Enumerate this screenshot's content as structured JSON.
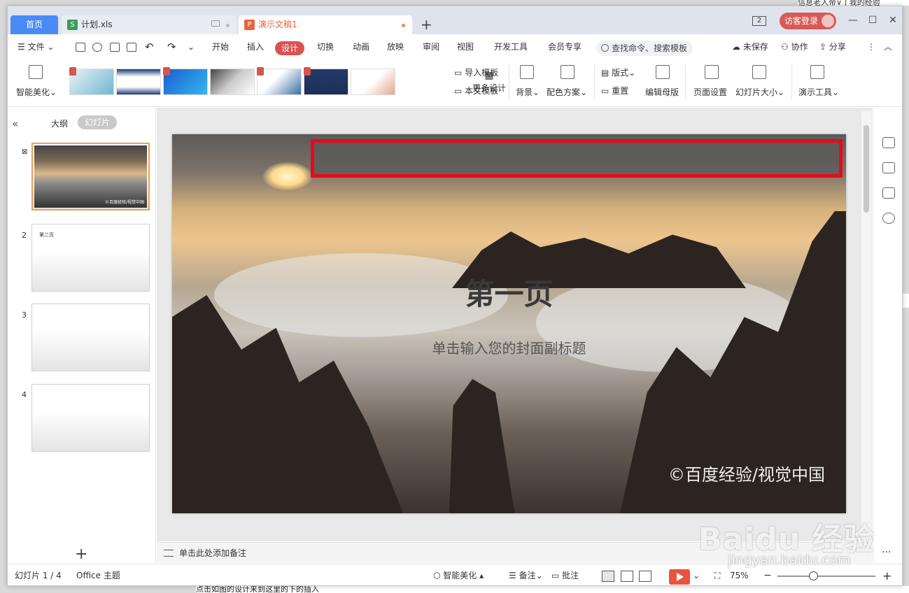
{
  "outside": {
    "top_text": "信息老人帝∨ | 我的经验",
    "bottom_text": "点击如图的设计来到这里的下的插入"
  },
  "tabs": {
    "home": "首页",
    "xls": {
      "label": "计划.xls",
      "icon": "S"
    },
    "ppt": {
      "label": "演示文稿1",
      "icon": "P"
    },
    "add": "+"
  },
  "title_right": {
    "badge": "2",
    "login": "访客登录",
    "min": "—",
    "max": "☐",
    "close": "✕"
  },
  "menu": {
    "file": "文件",
    "items": [
      "开始",
      "插入",
      "设计",
      "切换",
      "动画",
      "放映",
      "审阅",
      "视图",
      "开发工具",
      "会员专享"
    ],
    "active": "设计",
    "search": "查找命令、搜索模板",
    "unsaved": "未保存",
    "collab": "协作",
    "share": "分享"
  },
  "ribbon": {
    "smart": "智能美化",
    "more": "更多设计",
    "import_tpl": "导入模板",
    "doc_tpl": "本文模板",
    "background": "背景",
    "color_scheme": "配色方案",
    "layout": "版式",
    "reset": "重置",
    "edit_master": "编辑母版",
    "page_setup": "页面设置",
    "slide_size": "幻灯片大小",
    "present_tools": "演示工具"
  },
  "left_panel": {
    "outline_tab": "大纲",
    "slides_tab": "幻灯片",
    "slides": [
      {
        "num": "1",
        "title": ""
      },
      {
        "num": "2",
        "title": "第二页"
      },
      {
        "num": "3",
        "title": ""
      },
      {
        "num": "4",
        "title": ""
      }
    ],
    "thumb_wm": "©百度经验/视觉中国",
    "add": "+"
  },
  "slide": {
    "title": "第一页",
    "subtitle": "单击输入您的封面副标题",
    "watermark": "©百度经验/视觉中国"
  },
  "notes_placeholder": "单击此处添加备注",
  "status": {
    "slide_counter": "幻灯片 1 / 4",
    "theme": "Office 主题",
    "smart": "智能美化",
    "notes": "备注",
    "comments": "批注",
    "zoom": "75%",
    "minus": "−",
    "plus": "+"
  },
  "baidu": {
    "logo": "Baidu 经验",
    "url": "jingyan.baidu.com"
  },
  "colors": {
    "accent": "#d9534f",
    "home_tab": "#4a8af4",
    "highlight_box": "#e8091a",
    "play": "#e8543c"
  }
}
